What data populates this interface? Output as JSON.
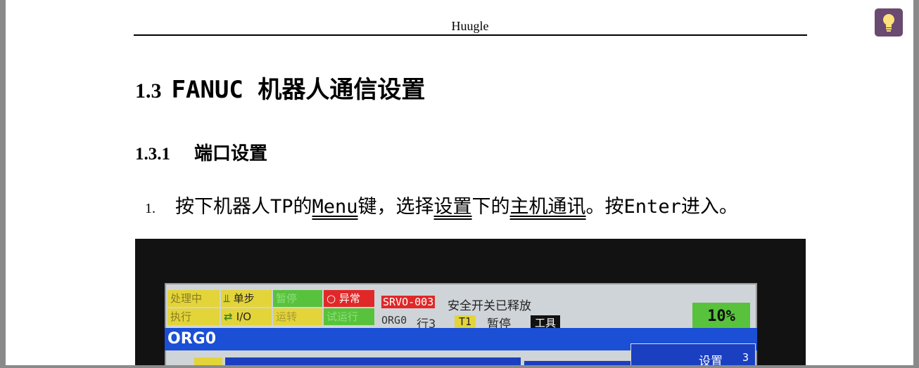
{
  "header": {
    "title": "Huugle"
  },
  "section": {
    "number": "1.3",
    "title": "FANUC 机器人通信设置"
  },
  "subsection": {
    "number": "1.3.1",
    "title": "端口设置"
  },
  "step1": {
    "number": "1.",
    "text_a": "按下机器人TP的",
    "menu": "Menu",
    "text_b": "键，选择",
    "setup": "设置",
    "text_c": "下的",
    "host_comm": "主机通讯",
    "text_d": "。按Enter进入。"
  },
  "pendant": {
    "status": {
      "processing": "处理中",
      "single_step": "单步",
      "hold": "暂停",
      "fault": "异常",
      "running": "执行",
      "io": "I/O",
      "run": "运转",
      "test_run": "试运行"
    },
    "alarm_code": "SRVO-003",
    "alarm_text": "安全开关已释放",
    "program": "ORG0",
    "line": "行3",
    "tool_frame": "T1",
    "state": "暂停",
    "tool_label": "工具",
    "override": "10%",
    "program_bar": "ORG0",
    "menu_setup": "设置",
    "menu_setup_index": "3",
    "menu_setup_2": "设置"
  },
  "colors": {
    "bulb_bg": "#6a4a70",
    "tp_green": "#58c23c",
    "tp_yellow": "#e3d43a",
    "tp_red": "#e02828",
    "tp_blue": "#1a4fd6"
  }
}
